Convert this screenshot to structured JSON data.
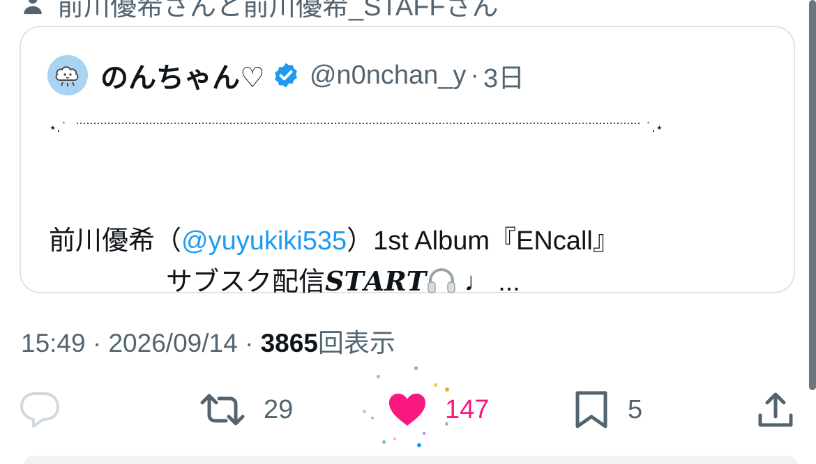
{
  "social_context": {
    "text": "前川優希さんと前川優希_STAFFさん",
    "icon": "person-icon"
  },
  "quote": {
    "display_name": "のんちゃん♡",
    "handle": "@n0nchan_y",
    "separator": "·",
    "age": "3日",
    "avatar_icon": "cloud-character-avatar",
    "verified_icon": "verified-badge-icon",
    "decor_left": "⋆.˙",
    "decor_right": "˙.⋆",
    "text_part1": "前川優希（",
    "mention": "@yuyukiki535",
    "text_part2": "）1st Album『ENcall』",
    "text_line2_prefix": "サブスク配信",
    "text_line2_start": "𝑺𝑻𝑨𝑹𝑻",
    "text_line2_suffix": " ♩ ..."
  },
  "meta": {
    "time": "15:49",
    "separator": " · ",
    "date": "2026/09/14",
    "views_count": "3865",
    "views_label": "回表示"
  },
  "actions": {
    "reply": {
      "icon": "reply-icon",
      "count": ""
    },
    "retweet": {
      "icon": "retweet-icon",
      "count": "29"
    },
    "like": {
      "icon": "heart-icon",
      "count": "147",
      "liked": true
    },
    "bookmark": {
      "icon": "bookmark-icon",
      "count": "5"
    },
    "share": {
      "icon": "share-icon"
    }
  },
  "colors": {
    "accent": "#1d9bf0",
    "like": "#f91880",
    "secondary_text": "#536471",
    "primary_text": "#0f1419",
    "border": "#dfe3e6"
  }
}
